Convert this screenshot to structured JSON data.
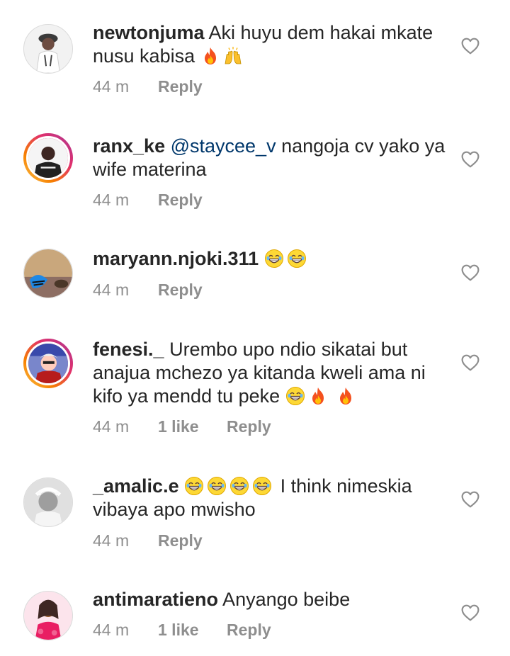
{
  "comments": [
    {
      "username": "newtonjuma",
      "text": " Aki huyu dem hakai mkate nusu kabisa ",
      "emojis": [
        "fire-emoji",
        "raising-hands-emoji"
      ],
      "time": "44 m",
      "reply": "Reply",
      "story_ring": false
    },
    {
      "username": "ranx_ke",
      "mention": " @staycee_v",
      "text": " nangoja cv yako ya wife materina",
      "time": "44 m",
      "reply": "Reply",
      "story_ring": true
    },
    {
      "username": "maryann.njoki.311",
      "text": " ",
      "emojis": [
        "laughing-tears-emoji",
        "laughing-tears-emoji"
      ],
      "time": "44 m",
      "reply": "Reply",
      "story_ring": false
    },
    {
      "username": "fenesi._",
      "text": " Urembo upo ndio sikatai but anajua mchezo ya kitanda kweli ama ni kifo ya mendd tu peke ",
      "emojis": [
        "laughing-tears-emoji",
        "fire-emoji",
        "fire-emoji"
      ],
      "time": "44 m",
      "likes": "1 like",
      "reply": "Reply",
      "story_ring": true
    },
    {
      "username": "_amalic.e",
      "text_after": "I think nimeskia vibaya apo mwisho",
      "emojis": [
        "laughing-tears-emoji",
        "laughing-tears-emoji",
        "laughing-tears-emoji",
        "laughing-tears-emoji"
      ],
      "time": "44 m",
      "reply": "Reply",
      "story_ring": false
    },
    {
      "username": "antimaratieno",
      "text": " Anyango beibe",
      "time": "44 m",
      "likes": "1 like",
      "reply": "Reply",
      "story_ring": false
    }
  ],
  "colors": {
    "username": "#262626",
    "mention": "#00376b",
    "meta": "#8e8e8e",
    "heart": "#8e8e8e"
  },
  "icons": {
    "like": "heart-outline-icon"
  }
}
